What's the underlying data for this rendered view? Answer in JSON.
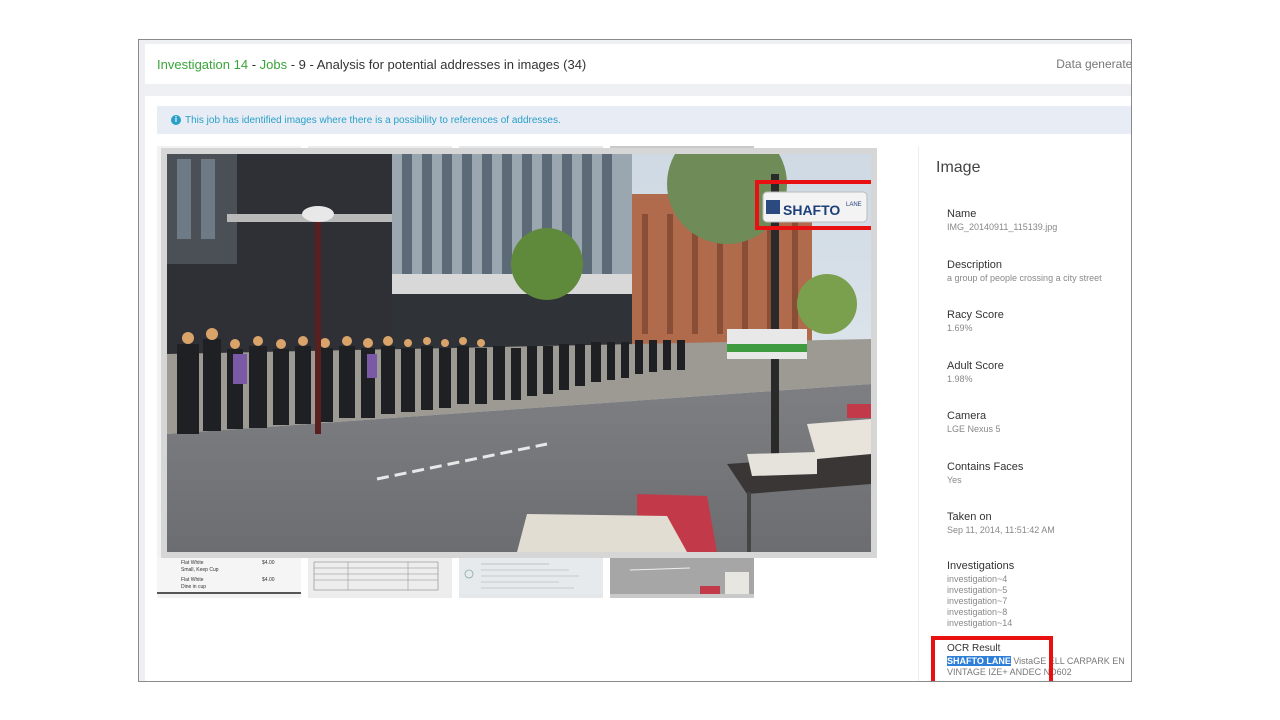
{
  "header": {
    "investigation": "Investigation 14",
    "sep1": " - ",
    "jobs": "Jobs",
    "rest": " - 9 - Analysis for potential addresses in images (34)",
    "data_generated": "Data generated"
  },
  "alert": {
    "icon": "info-circle-icon",
    "text": "This job has identified images where there is a possibility to references of addresses."
  },
  "viewer": {
    "sign_text": "SHAFTO",
    "sign_small": "LANE",
    "highlight_color": "#e81010"
  },
  "thumbnails": [
    {
      "lines": [
        "Flat White",
        "Small, Keep Cup",
        "Flat White",
        "Dine in cup"
      ],
      "prices": [
        "$4.00",
        "$4.00"
      ]
    },
    {
      "lines": []
    },
    {
      "lines": []
    },
    {
      "lines": []
    }
  ],
  "image": {
    "title": "Image",
    "name_label": "Name",
    "name_value": "IMG_20140911_115139.jpg",
    "description_label": "Description",
    "description_value": "a group of people crossing a city street",
    "racy_label": "Racy Score",
    "racy_value": "1.69%",
    "adult_label": "Adult Score",
    "adult_value": "1.98%",
    "camera_label": "Camera",
    "camera_value": "LGE Nexus 5",
    "faces_label": "Contains Faces",
    "faces_value": "Yes",
    "taken_label": "Taken on",
    "taken_value": "Sep 11, 2014, 11:51:42 AM",
    "investigations_label": "Investigations",
    "investigations": [
      "investigation~4",
      "investigation~5",
      "investigation~7",
      "investigation~8",
      "investigation~14"
    ],
    "ocr_label": "OCR Result",
    "ocr_highlight": "SHAFTO LANE",
    "ocr_rest": " VistaGE  ELL CARPARK EN",
    "ocr_line2": "VINTAGE IZE+ ANDEC  ND602"
  }
}
